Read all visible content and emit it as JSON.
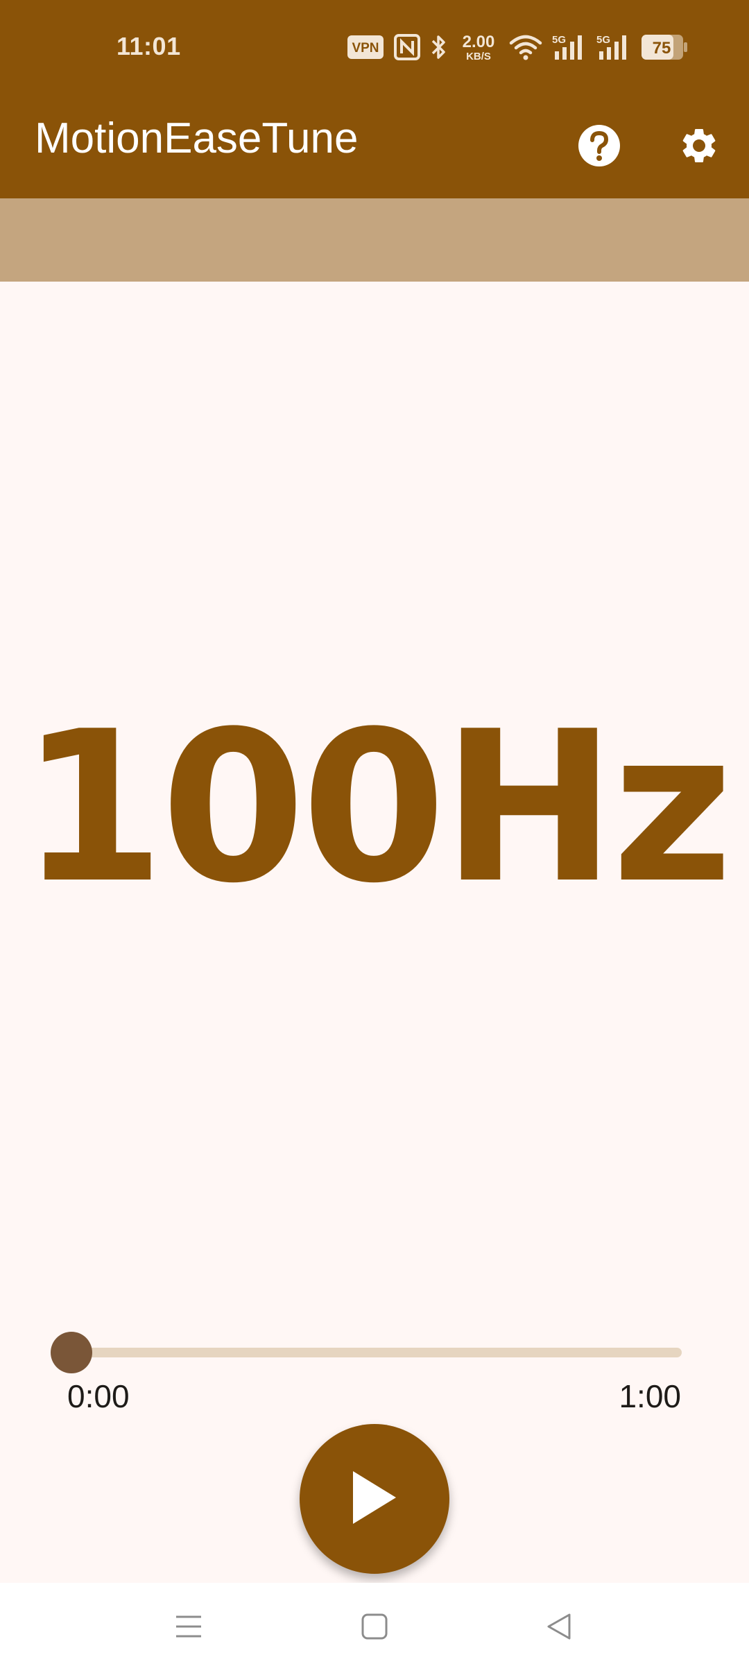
{
  "status_bar": {
    "time": "11:01",
    "vpn_label": "VPN",
    "net_speed_value": "2.00",
    "net_speed_unit": "KB/S",
    "signal1_label": "5G",
    "signal2_label": "5G",
    "battery_level": "75",
    "icons": [
      "vpn-icon",
      "nfc-icon",
      "bluetooth-icon",
      "net-speed",
      "wifi-icon",
      "signal-5g-icon",
      "signal-5g-icon",
      "battery-icon"
    ]
  },
  "app_bar": {
    "title": "MotionEaseTune",
    "help_icon": "help-icon",
    "settings_icon": "gear-icon"
  },
  "main": {
    "frequency": "100Hz"
  },
  "player": {
    "current_time": "0:00",
    "total_time": "1:00",
    "progress_fraction": 0,
    "play_icon": "play-icon"
  },
  "nav_bar": {
    "icons": [
      "recents-icon",
      "home-icon",
      "back-icon"
    ]
  },
  "colors": {
    "primary": "#8A5308",
    "banner": "#C4A57F",
    "background": "#FFF7F5",
    "seek_track": "#E6D5C0",
    "seek_thumb": "#7A5638"
  }
}
